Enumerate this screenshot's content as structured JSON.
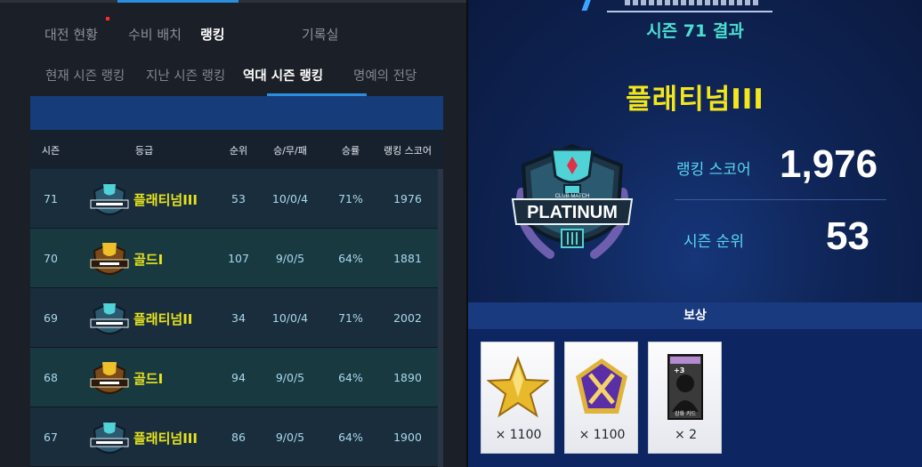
{
  "left": {
    "main_tabs": [
      "대전 현황",
      "수비 배치",
      "랭킹",
      "기록실"
    ],
    "sub_tabs": [
      "현재 시즌 랭킹",
      "지난 시즌 랭킹",
      "역대 시즌 랭킹",
      "명예의 전당"
    ],
    "table": {
      "headers": [
        "시즌",
        "등급",
        "순위",
        "승/무/패",
        "승률",
        "랭킹 스코어"
      ],
      "rows": [
        {
          "season": "71",
          "tier": "플래티넘III",
          "badge": "platinum",
          "rank": "53",
          "record": "10/0/4",
          "winrate": "71%",
          "score": "1976"
        },
        {
          "season": "70",
          "tier": "골드I",
          "badge": "gold",
          "rank": "107",
          "record": "9/0/5",
          "winrate": "64%",
          "score": "1881"
        },
        {
          "season": "69",
          "tier": "플래티넘II",
          "badge": "platinum",
          "rank": "34",
          "record": "10/0/4",
          "winrate": "71%",
          "score": "2002"
        },
        {
          "season": "68",
          "tier": "골드I",
          "badge": "gold",
          "rank": "94",
          "record": "9/0/5",
          "winrate": "64%",
          "score": "1890"
        },
        {
          "season": "67",
          "tier": "플래티넘III",
          "badge": "platinum",
          "rank": "86",
          "record": "9/0/5",
          "winrate": "64%",
          "score": "1900"
        }
      ]
    }
  },
  "right": {
    "season_result": "시즌 71 결과",
    "tier": "플래티넘III",
    "badge_text": "PLATINUM",
    "badge_subtext": "CLUB MATCH",
    "score_label": "랭킹 스코어",
    "score_value": "1,976",
    "rank_label": "시즌 순위",
    "rank_value": "53",
    "reward_title": "보상",
    "rewards": [
      {
        "icon": "gold-star-icon",
        "qty": "× 1100"
      },
      {
        "icon": "purple-emblem-icon",
        "qty": "× 1100"
      },
      {
        "icon": "enhance-card-icon",
        "qty": "× 2",
        "card_label": "강화 카드",
        "card_plus": "+3"
      }
    ]
  },
  "colors": {
    "accent_blue": "#2a8fe0",
    "tier_yellow": "#e8e41e",
    "teal": "#4be0d0",
    "cell_text": "#a9d9ee"
  }
}
